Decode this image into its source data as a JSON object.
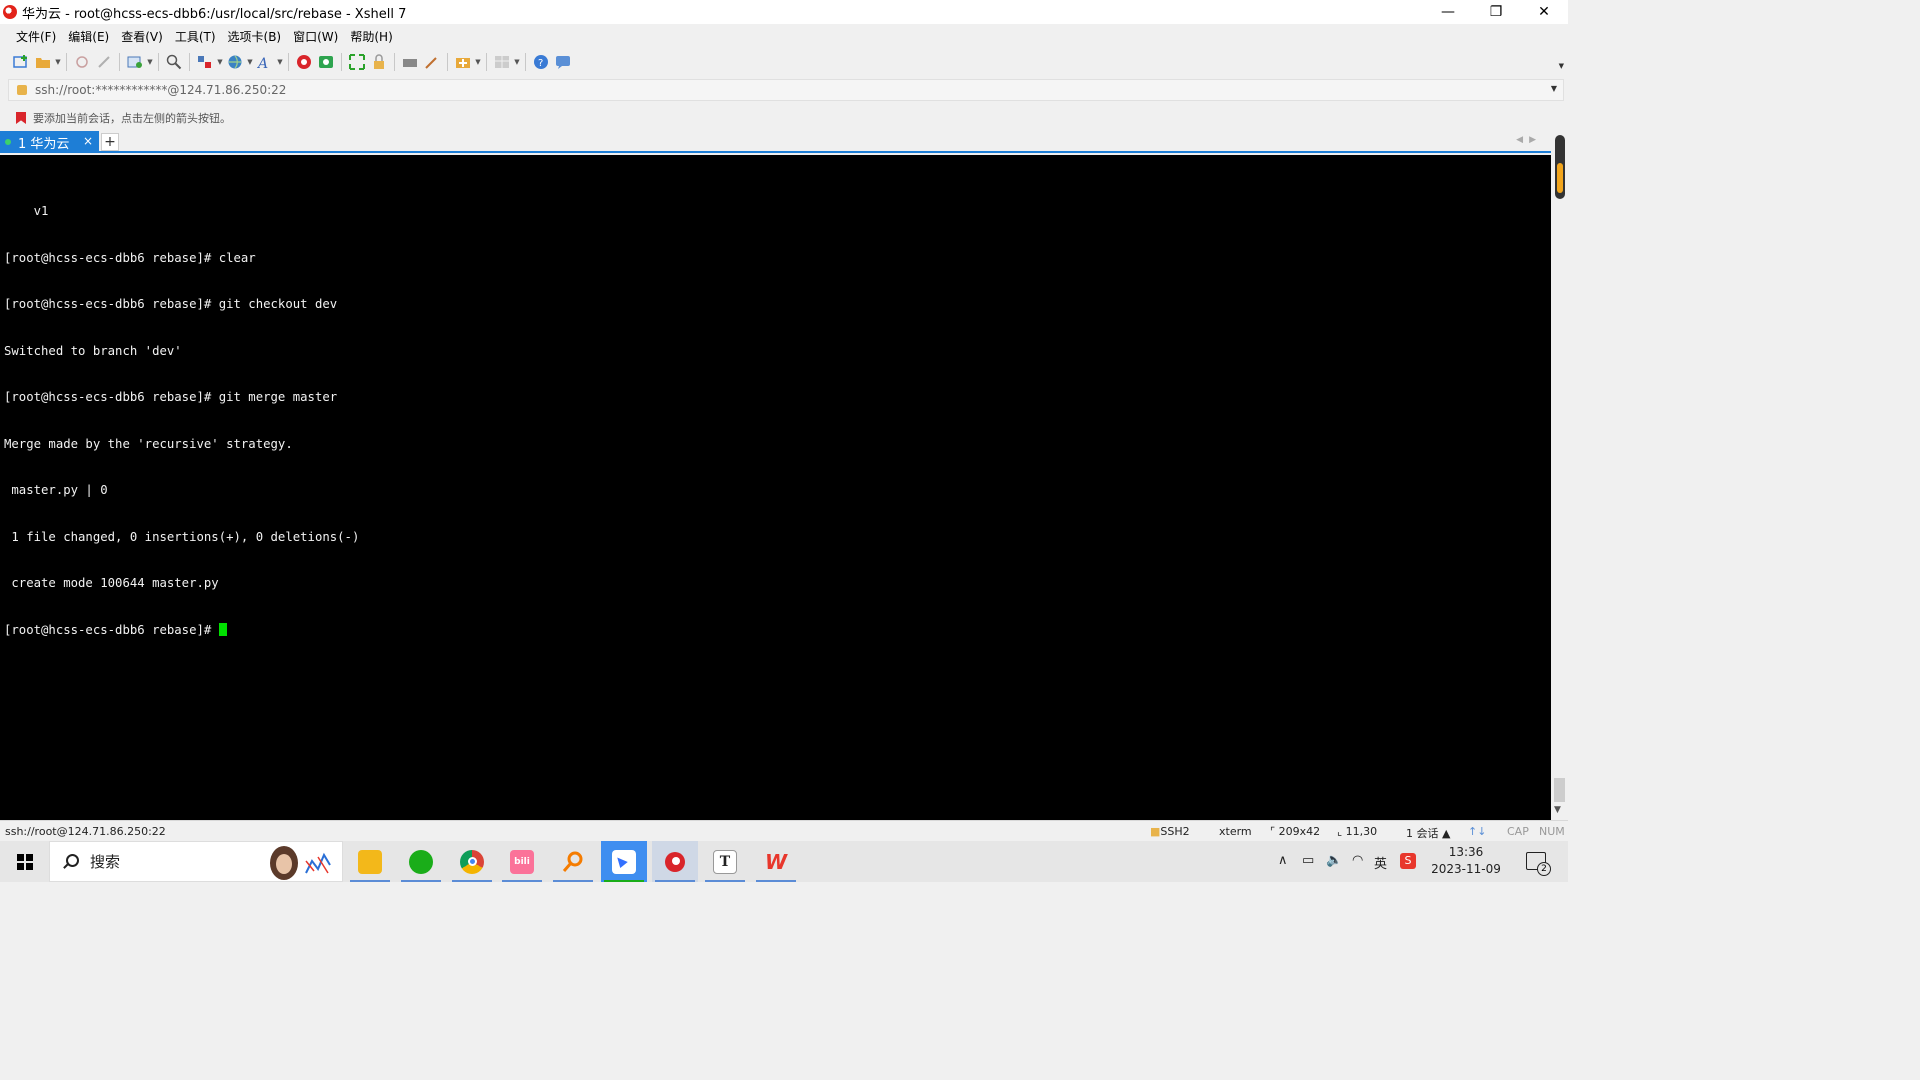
{
  "window": {
    "title": "华为云 - root@hcss-ecs-dbb6:/usr/local/src/rebase - Xshell 7",
    "controls": {
      "minimize": "—",
      "restore": "❐",
      "close": "✕"
    }
  },
  "menu": [
    "文件(F)",
    "编辑(E)",
    "查看(V)",
    "工具(T)",
    "选项卡(B)",
    "窗口(W)",
    "帮助(H)"
  ],
  "toolbar": {
    "icons": [
      "new-session-icon",
      "open-folder-icon",
      "reconnect-icon",
      "disconnect-icon",
      "new-window-icon",
      "find-icon",
      "layout-icon",
      "globe-icon",
      "font-icon",
      "xshell-icon",
      "xftp-icon",
      "fullscreen-icon",
      "lock-icon",
      "keyboard-icon",
      "script-icon",
      "add-bookmark-icon",
      "grid-icon",
      "help-icon",
      "chat-icon"
    ]
  },
  "address": {
    "value": "ssh://root:************@124.71.86.250:22"
  },
  "hint": {
    "text": "要添加当前会话，点击左侧的箭头按钮。"
  },
  "tabs": [
    {
      "label": "1 华为云",
      "close": "×"
    }
  ],
  "tab_add": "+",
  "terminal": {
    "lines": [
      "    v1",
      "[root@hcss-ecs-dbb6 rebase]# clear",
      "[root@hcss-ecs-dbb6 rebase]# git checkout dev",
      "Switched to branch 'dev'",
      "[root@hcss-ecs-dbb6 rebase]# git merge master",
      "Merge made by the 'recursive' strategy.",
      " master.py | 0",
      " 1 file changed, 0 insertions(+), 0 deletions(-)",
      " create mode 100644 master.py"
    ],
    "prompt": "[root@hcss-ecs-dbb6 rebase]# ",
    "cursor_color": "#00e000"
  },
  "status": {
    "connection": "ssh://root@124.71.86.250:22",
    "protocol": "SSH2",
    "terminal_type": "xterm",
    "size": "209x42",
    "cursor_pos": "11,30",
    "sessions": "1 会话",
    "caps": "CAP",
    "num": "NUM"
  },
  "taskbar": {
    "search_placeholder": "搜索",
    "apps": [
      {
        "name": "file-explorer-icon",
        "color": "#f3b81a",
        "glyph": ""
      },
      {
        "name": "wechat-icon",
        "color": "#1aad19",
        "glyph": ""
      },
      {
        "name": "chrome-icon",
        "color": "#db4437",
        "glyph": ""
      },
      {
        "name": "bilibili-icon",
        "color": "#fb7299",
        "glyph": "bili"
      },
      {
        "name": "search-app-icon",
        "color": "#f57c00",
        "glyph": ""
      },
      {
        "name": "feishu-icon",
        "color": "#3370ff",
        "glyph": ""
      },
      {
        "name": "xshell-icon",
        "color": "#d9252b",
        "glyph": ""
      },
      {
        "name": "typora-icon",
        "color": "#ffffff",
        "glyph": "T"
      },
      {
        "name": "wps-icon",
        "color": "#e8372c",
        "glyph": "W"
      }
    ],
    "tray": {
      "ime": "英",
      "time": "13:36",
      "date": "2023-11-09",
      "notifications": "2"
    }
  }
}
